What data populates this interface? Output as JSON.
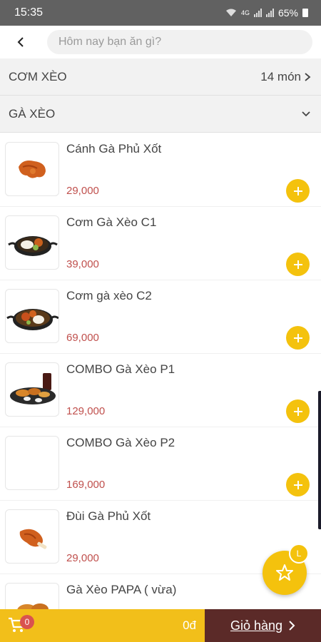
{
  "status_bar": {
    "time": "15:35",
    "battery": "65%",
    "network": "4G"
  },
  "search": {
    "placeholder": "Hôm nay bạn ăn gì?"
  },
  "categories": [
    {
      "name": "CƠM XÈO",
      "count": "14 món"
    },
    {
      "name": "GÀ XÈO"
    }
  ],
  "items": [
    {
      "name": "Cánh Gà Phủ Xốt",
      "price": "29,000",
      "image": "chicken-wing"
    },
    {
      "name": "Cơm Gà Xèo C1",
      "price": "39,000",
      "image": "rice-pan-1"
    },
    {
      "name": "Cơm gà xèo C2",
      "price": "69,000",
      "image": "rice-pan-2"
    },
    {
      "name": "COMBO Gà Xèo P1",
      "price": "129,000",
      "image": "combo-platter"
    },
    {
      "name": "COMBO Gà Xèo P2",
      "price": "169,000",
      "image": ""
    },
    {
      "name": "Đùi Gà Phủ Xốt",
      "price": "29,000",
      "image": "chicken-drumstick"
    },
    {
      "name": "Gà Xèo PAPA ( vừa)",
      "price": "",
      "image": "fried-chicken"
    }
  ],
  "fab": {
    "icon": "star-icon",
    "badge": "L"
  },
  "cart": {
    "count": "0",
    "total": "0đ",
    "button_label": "Giỏ hàng"
  },
  "colors": {
    "accent": "#f4c20d",
    "price": "#c0504d",
    "cart_button": "#5b2a28"
  }
}
